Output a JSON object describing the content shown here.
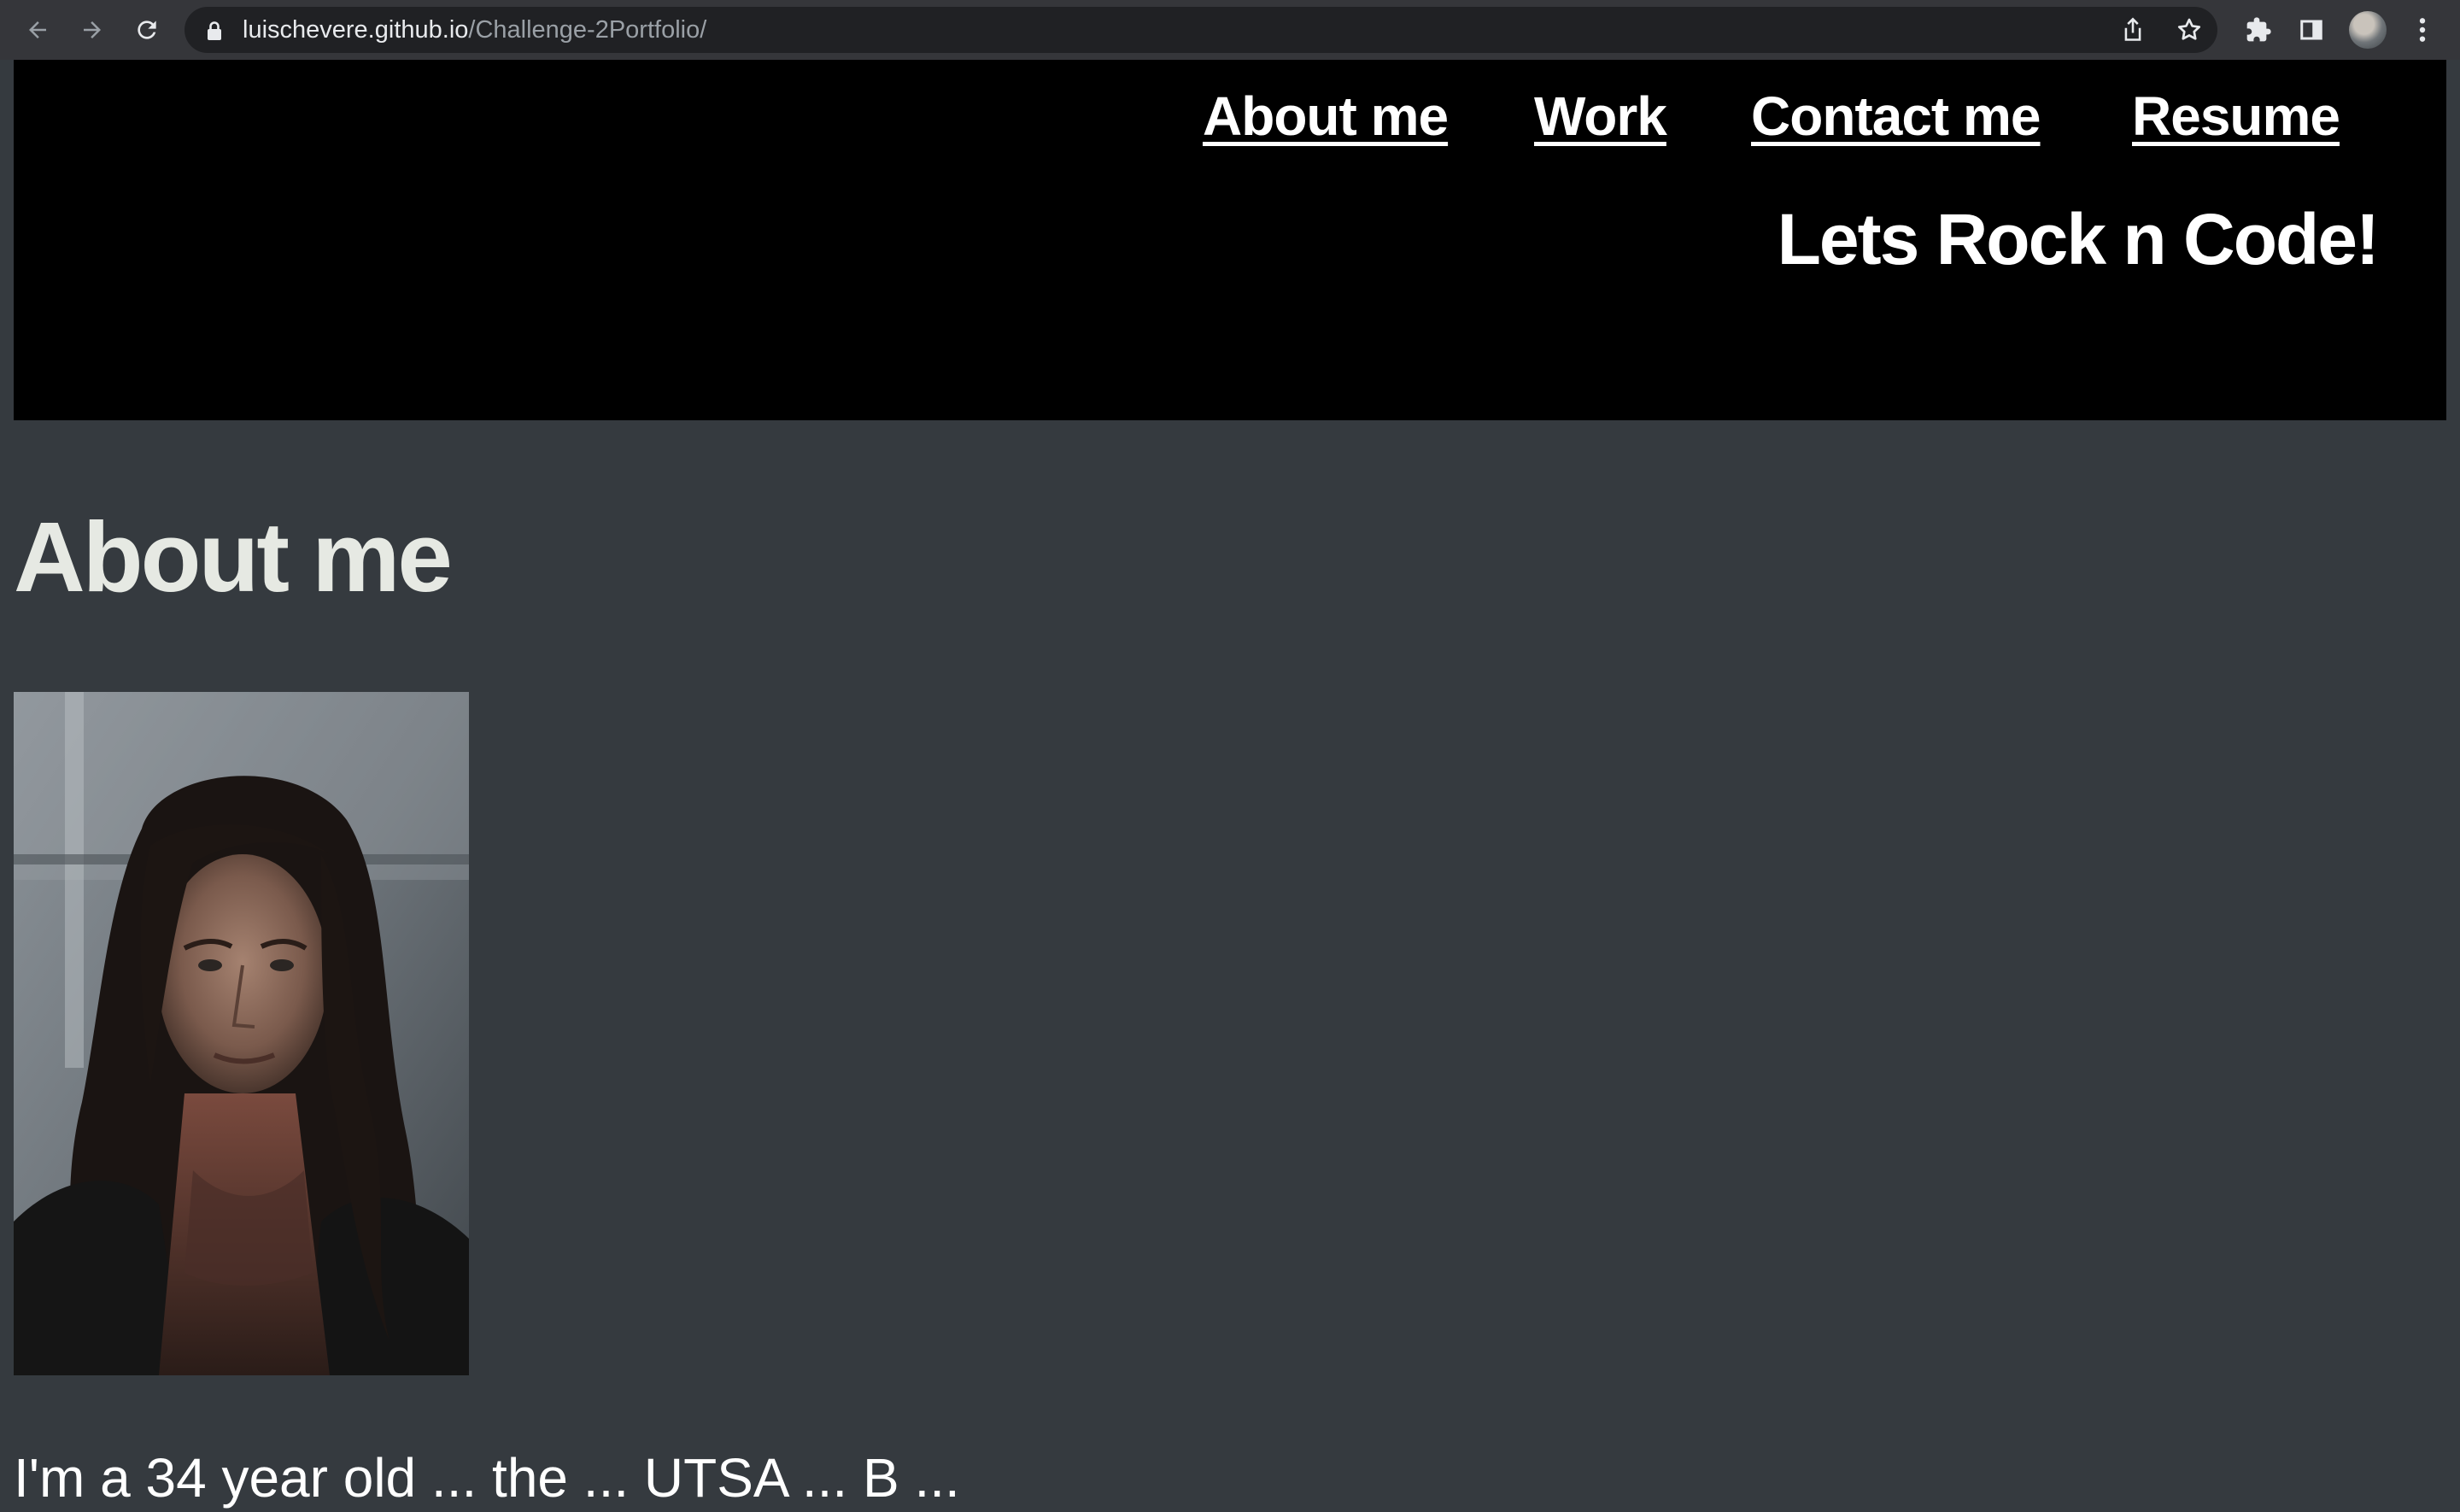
{
  "browser": {
    "url_host": "luischevere.github.io",
    "url_path": "/Challenge-2Portfolio/",
    "icons": [
      "back-arrow-icon",
      "forward-arrow-icon",
      "reload-icon",
      "lock-icon",
      "share-icon",
      "bookmark-star-icon",
      "extensions-puzzle-icon",
      "side-panel-icon",
      "profile-avatar",
      "more-menu-icon"
    ]
  },
  "header": {
    "nav": [
      {
        "label": "About me"
      },
      {
        "label": "Work"
      },
      {
        "label": "Contact me"
      },
      {
        "label": "Resume"
      }
    ],
    "tagline": "Lets Rock n Code!"
  },
  "about": {
    "title": "About me",
    "bio_visible_fragment": "I'm a 34 year old  ...  the  ...  UTSA  ...  B  ...  "
  },
  "colors": {
    "page_background": "#353a3f",
    "header_background": "#000000",
    "heading_text": "#e6e9e3",
    "nav_text": "#ffffff"
  }
}
